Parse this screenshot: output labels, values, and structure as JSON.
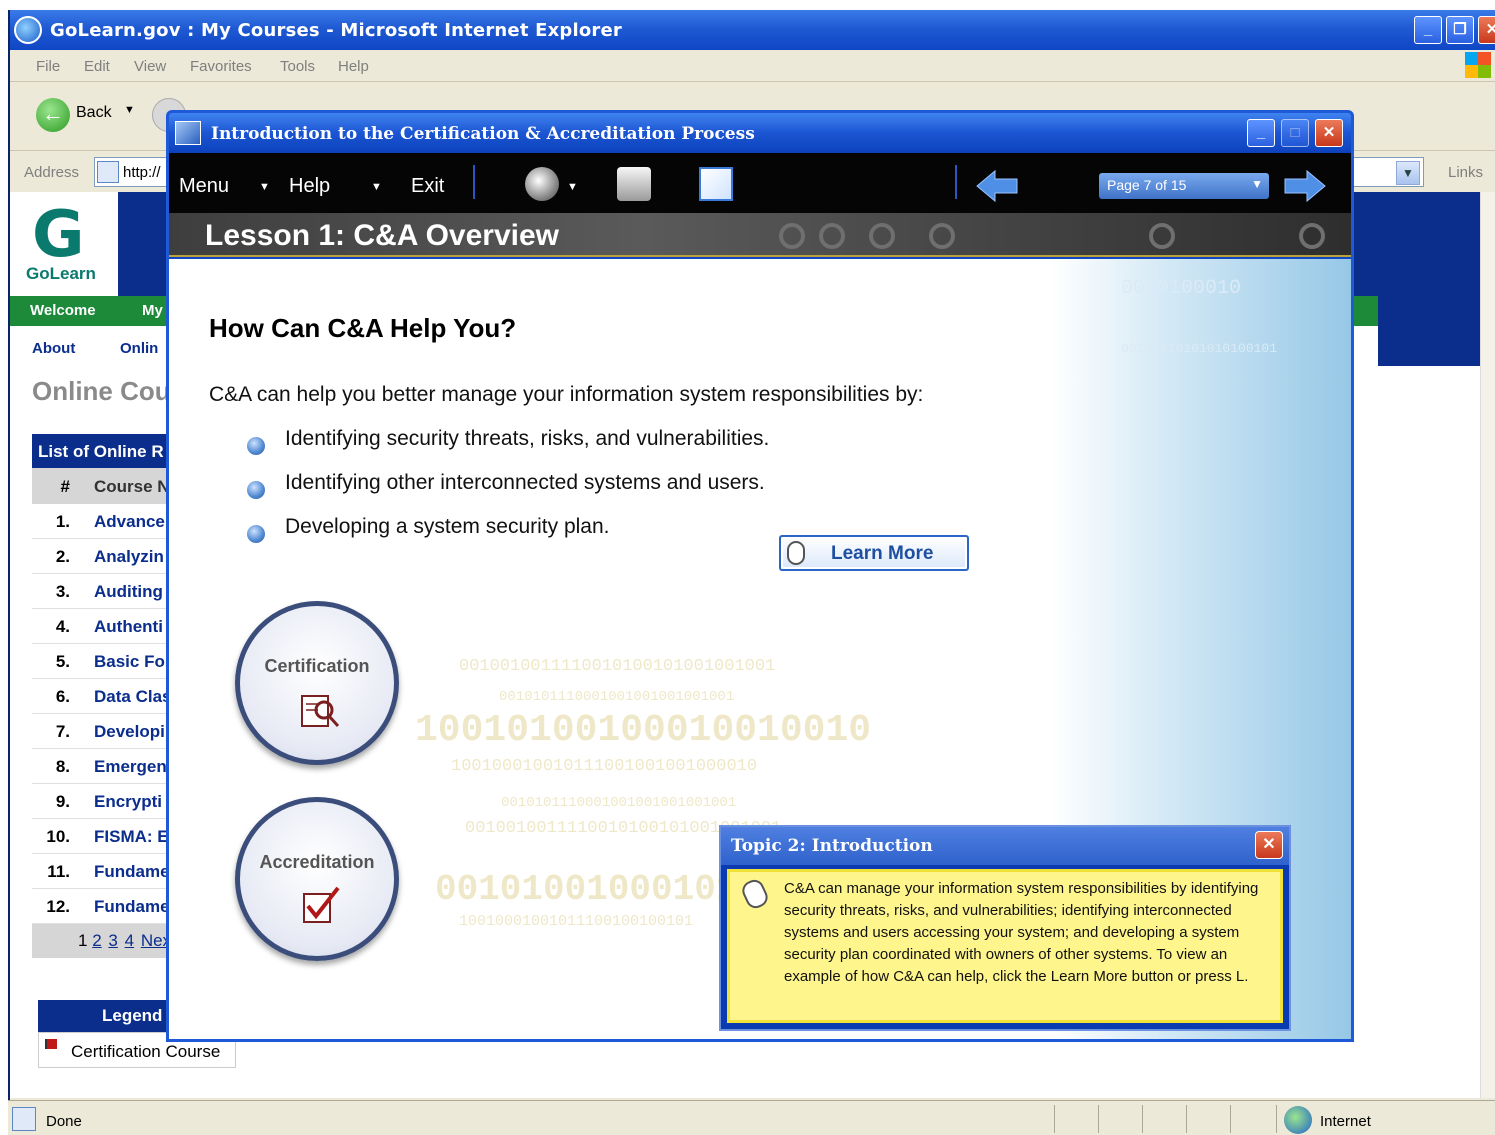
{
  "browser": {
    "title": "GoLearn.gov : My Courses - Microsoft Internet Explorer",
    "menu": [
      "File",
      "Edit",
      "View",
      "Favorites",
      "Tools",
      "Help"
    ],
    "back_label": "Back",
    "address_label": "Address",
    "address_value": "http://",
    "links_label": "Links",
    "status_text": "Done",
    "zone_text": "Internet"
  },
  "site": {
    "logo_text": "GoLearn",
    "nav_primary": [
      "Welcome",
      "My"
    ],
    "nav_secondary": [
      "About",
      "Onlin"
    ],
    "heading": "Online Cou",
    "table_title": "List of Online R",
    "col_num": "#",
    "col_name": "Course N",
    "rows": [
      {
        "num": "1.",
        "name": "Advance"
      },
      {
        "num": "2.",
        "name": "Analyzin"
      },
      {
        "num": "3.",
        "name": "Auditing"
      },
      {
        "num": "4.",
        "name": "Authenti"
      },
      {
        "num": "5.",
        "name": "Basic Fo"
      },
      {
        "num": "6.",
        "name": "Data Clas"
      },
      {
        "num": "7.",
        "name": "Developi"
      },
      {
        "num": "8.",
        "name": "Emergen"
      },
      {
        "num": "9.",
        "name": "Encrypti"
      },
      {
        "num": "10.",
        "name": "FISMA: E"
      },
      {
        "num": "11.",
        "name": "Fundame"
      },
      {
        "num": "12.",
        "name": "Fundame"
      }
    ],
    "pager": {
      "current": "1",
      "pages": [
        "2",
        "3",
        "4"
      ],
      "next": "Nex"
    },
    "legend_title": "Legend",
    "legend_item": "Certification Course"
  },
  "course": {
    "window_title": "Introduction to the Certification & Accreditation Process",
    "toolbar": {
      "menu": "Menu",
      "help": "Help",
      "exit": "Exit",
      "page_indicator": "Page 7 of 15"
    },
    "lesson_title": "Lesson 1: C&A Overview",
    "heading": "How Can C&A Help You?",
    "intro": "C&A can help you better manage your information system responsibilities by:",
    "bullets": [
      "Identifying security threats, risks, and vulnerabilities.",
      "Identifying other interconnected systems and users.",
      "Developing a system security plan."
    ],
    "learn_more": "Learn More",
    "circles": [
      "Certification",
      "Accreditation"
    ],
    "binary": [
      "0010010011110010100101001001001",
      "0010101110001001001001001001",
      "10010100100010010010",
      "100100010010111001001001000010",
      "0010101110001001001001001001",
      "0010010011110010100101001001001",
      "00101001000101",
      "10010001001011100100100101"
    ],
    "topic": {
      "title": "Topic 2: Introduction",
      "text": "C&A can manage your information system responsibilities by identifying security threats, risks, and vulnerabilities; identifying interconnected systems and users accessing your system; and developing a system security plan coordinated with owners of other systems. To view an example of how C&A can help, click the Learn More button or press L."
    },
    "art_binary": [
      "0010100010",
      "00101010101010100101"
    ]
  },
  "colors": {
    "xp_blue": "#1f5ad3",
    "golearn_navy": "#0b2d8c",
    "golearn_green": "#1d8a3a",
    "topic_yellow": "#fef68d",
    "close_red": "#c8381b"
  },
  "icons": [
    "ie-icon",
    "windows-flag-icon",
    "back-arrow-icon",
    "page-icon",
    "globe-icon",
    "speaker-icon",
    "printer-icon",
    "notes-icon",
    "prev-arrow-icon",
    "next-arrow-icon",
    "mouse-icon",
    "magnifier-document-icon",
    "checkmark-document-icon",
    "flag-icon",
    "close-icon"
  ]
}
